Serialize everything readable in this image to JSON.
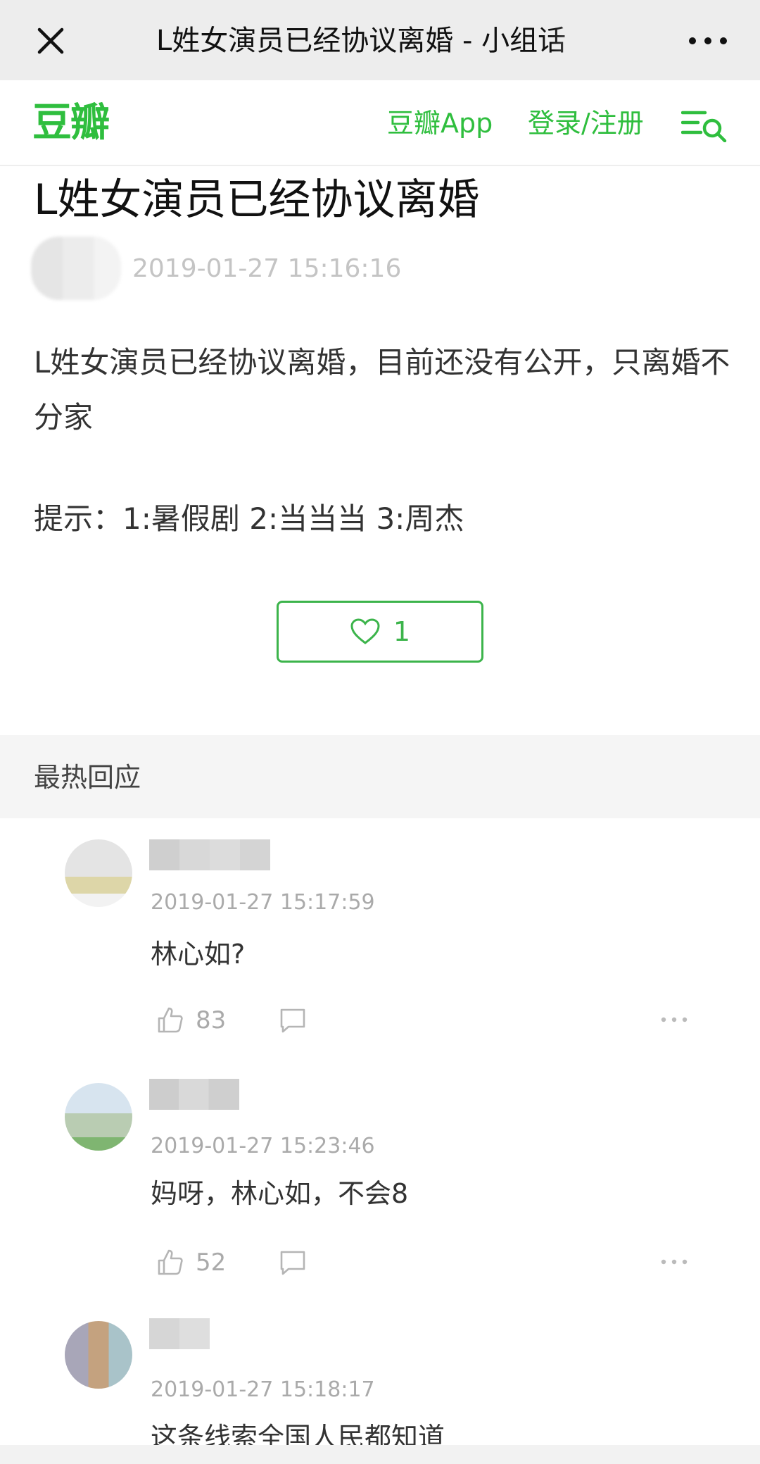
{
  "browser": {
    "title": "L姓女演员已经协议离婚 - 小组话",
    "close_icon": "close-icon",
    "more_icon": "more-horizontal-icon"
  },
  "header": {
    "logo": "豆瓣",
    "app_link": "豆瓣App",
    "login_link": "登录/注册",
    "menu_icon": "menu-search-icon",
    "brand_color": "#2fbe3e"
  },
  "post": {
    "title": "L姓女演员已经协议离婚",
    "time": "2019-01-27 15:16:16",
    "body": "L姓女演员已经协议离婚，目前还没有公开，只离婚不分家",
    "hint": "提示：1:暑假剧 2:当当当  3:周杰",
    "like_count": "1"
  },
  "hot_replies": {
    "header": "最热回应",
    "comments": [
      {
        "time": "2019-01-27 15:17:59",
        "text": "林心如?",
        "likes": "83"
      },
      {
        "time": "2019-01-27 15:23:46",
        "text": "妈呀，林心如，不会8",
        "likes": "52"
      },
      {
        "time": "2019-01-27 15:18:17",
        "text": "这条线索全国人民都知道",
        "likes": ""
      }
    ]
  }
}
